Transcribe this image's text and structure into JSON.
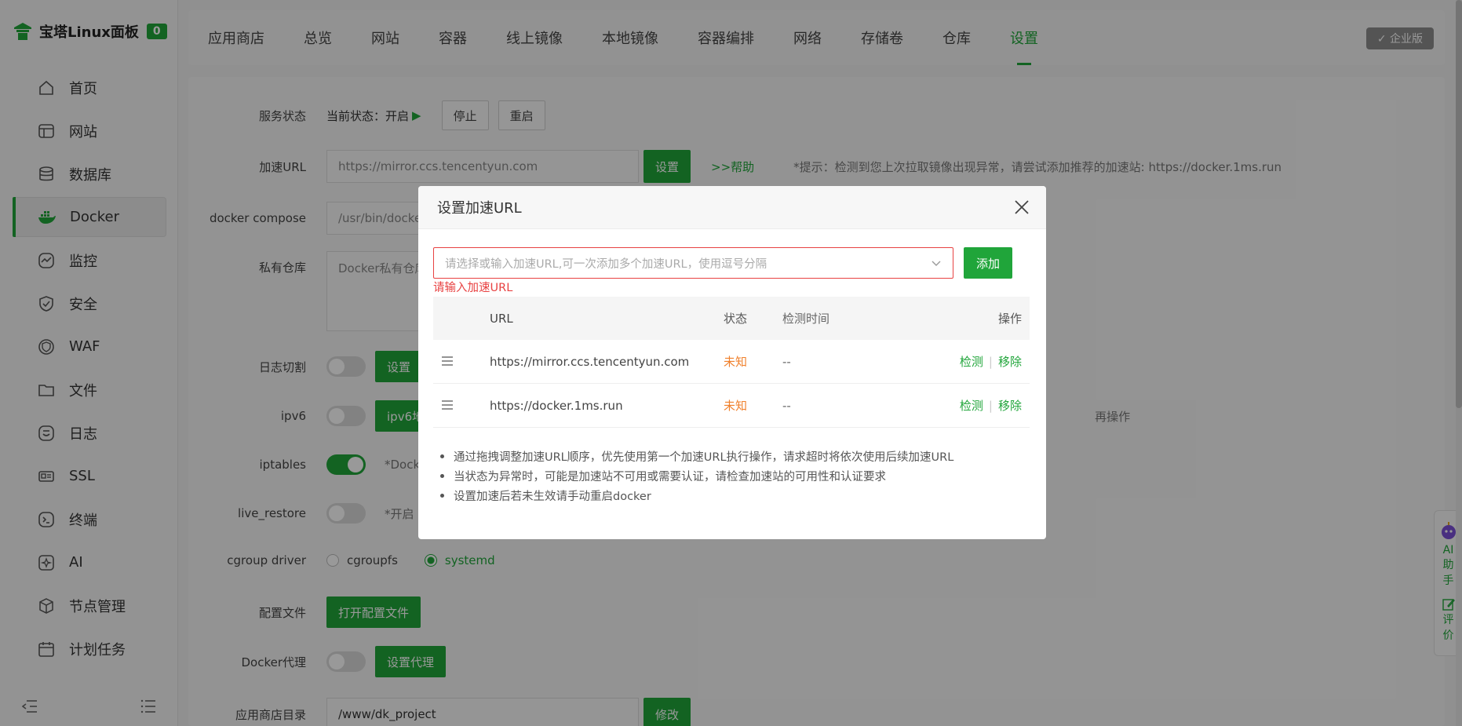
{
  "brand": {
    "title": "宝塔Linux面板",
    "badge": "0"
  },
  "sidebar": {
    "items": [
      {
        "label": "首页",
        "icon": "home-icon"
      },
      {
        "label": "网站",
        "icon": "globe-icon"
      },
      {
        "label": "数据库",
        "icon": "database-icon"
      },
      {
        "label": "Docker",
        "icon": "docker-icon",
        "active": true
      },
      {
        "label": "监控",
        "icon": "monitor-icon"
      },
      {
        "label": "安全",
        "icon": "shield-icon"
      },
      {
        "label": "WAF",
        "icon": "waf-icon"
      },
      {
        "label": "文件",
        "icon": "folder-icon"
      },
      {
        "label": "日志",
        "icon": "log-icon"
      },
      {
        "label": "SSL",
        "icon": "ssl-icon"
      },
      {
        "label": "终端",
        "icon": "terminal-icon"
      },
      {
        "label": "AI",
        "icon": "ai-icon"
      },
      {
        "label": "节点管理",
        "icon": "node-icon"
      },
      {
        "label": "计划任务",
        "icon": "calendar-icon"
      }
    ]
  },
  "tabs": {
    "items": [
      "应用商店",
      "总览",
      "网站",
      "容器",
      "线上镜像",
      "本地镜像",
      "容器编排",
      "网络",
      "存储卷",
      "仓库",
      "设置"
    ],
    "active": "设置",
    "enterprise": "企业版"
  },
  "settings": {
    "service_status_label": "服务状态",
    "service_status_value": "当前状态：开启",
    "stop_label": "停止",
    "restart_label": "重启",
    "accel_url_label": "加速URL",
    "accel_url_value": "https://mirror.ccs.tencentyun.com",
    "set_label": "设置",
    "help_label": ">>帮助",
    "accel_hint": "*提示：检测到您上次拉取镜像出现异常，请尝试添加推荐的加速站: https://docker.1ms.run",
    "compose_label": "docker compose",
    "compose_value": "/usr/bin/docke",
    "private_repo_label": "私有仓库",
    "private_repo_placeholder": "Docker私有仓库",
    "log_cut_label": "日志切割",
    "log_cut_btn": "设置",
    "ipv6_label": "ipv6",
    "ipv6_btn": "ipv6地",
    "ipv6_hint": "再操作",
    "iptables_label": "iptables",
    "iptables_hint": "*Dock",
    "live_restore_label": "live_restore",
    "live_restore_hint": "*开启",
    "cgroup_label": "cgroup driver",
    "cgroup_opt1": "cgroupfs",
    "cgroup_opt2": "systemd",
    "config_label": "配置文件",
    "config_btn": "打开配置文件",
    "proxy_label": "Docker代理",
    "proxy_btn": "设置代理",
    "appdir_label": "应用商店目录",
    "appdir_value": "/www/dk_project",
    "appdir_btn": "修改"
  },
  "modal": {
    "title": "设置加速URL",
    "select_placeholder": "请选择或输入加速URL,可一次添加多个加速URL，使用逗号分隔",
    "add_label": "添加",
    "error": "请输入加速URL",
    "columns": {
      "url": "URL",
      "state": "状态",
      "time": "检测时间",
      "op": "操作"
    },
    "rows": [
      {
        "url": "https://mirror.ccs.tencentyun.com",
        "state": "未知",
        "time": "--",
        "check": "检测",
        "remove": "移除"
      },
      {
        "url": "https://docker.1ms.run",
        "state": "未知",
        "time": "--",
        "check": "检测",
        "remove": "移除"
      }
    ],
    "tips": [
      "通过拖拽调整加速URL顺序，优先使用第一个加速URL执行操作，请求超时将依次使用后续加速URL",
      "当状态为异常时，可能是加速站不可用或需要认证，请检查加速站的可用性和认证要求",
      "设置加速后若未生效请手动重启docker"
    ]
  },
  "ai_widget": {
    "ai": "AI",
    "assistant1": "助",
    "assistant2": "手",
    "rate1": "评",
    "rate2": "价"
  },
  "colors": {
    "accent": "#20a53a",
    "error": "#e84242",
    "warning": "#f0802c"
  }
}
